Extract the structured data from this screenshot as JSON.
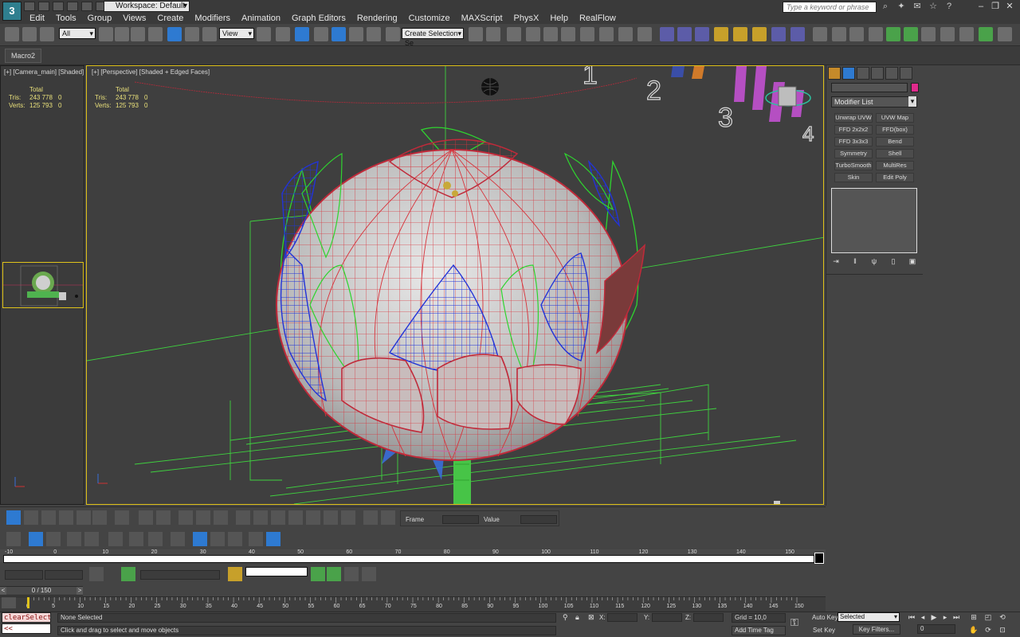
{
  "title_bar": {
    "workspace": "Workspace: Default",
    "search_placeholder": "Type a keyword or phrase"
  },
  "menu": [
    "Edit",
    "Tools",
    "Group",
    "Views",
    "Create",
    "Modifiers",
    "Animation",
    "Graph Editors",
    "Rendering",
    "Customize",
    "MAXScript",
    "PhysX",
    "Help",
    "RealFlow"
  ],
  "toolbar": {
    "selection_filter": "All",
    "ref_coord": "View",
    "named_selection": "Create Selection Se"
  },
  "ribbon": {
    "macro_tab": "Macro2"
  },
  "viewport_left": {
    "label": "[+] [Camera_main] [Shaded]",
    "stats": {
      "header": "Total",
      "tris_label": "Tris:",
      "tris_value": "243 778",
      "tris_sel": "0",
      "verts_label": "Verts:",
      "verts_value": "125 793",
      "verts_sel": "0"
    }
  },
  "viewport_main": {
    "label": "[+] [Perspective] [Shaded + Edged Faces]",
    "stats": {
      "header": "Total",
      "tris_label": "Tris:",
      "tris_value": "243 778",
      "tris_sel": "0",
      "verts_label": "Verts:",
      "verts_value": "125 793",
      "verts_sel": "0"
    },
    "background_numbers": [
      "1",
      "2",
      "3",
      "4"
    ]
  },
  "command_panel": {
    "modifier_list": "Modifier List",
    "modifiers": [
      "Unwrap UVW",
      "UVW Map",
      "FFD 2x2x2",
      "FFD(box)",
      "FFD 3x3x3",
      "Bend",
      "Symmetry",
      "Shell",
      "TurboSmooth",
      "MultiRes",
      "Skin",
      "Edit Poly"
    ],
    "object_color": "#e02a8c"
  },
  "bottom": {
    "frame_label": "Frame",
    "value_label": "Value",
    "time_slider": "0 / 150",
    "track_ruler": [
      "-10",
      "0",
      "10",
      "20",
      "30",
      "40",
      "50",
      "60",
      "70",
      "80",
      "90",
      "100",
      "110",
      "120",
      "130",
      "140",
      "150"
    ],
    "timeline": [
      "0",
      "5",
      "10",
      "15",
      "20",
      "25",
      "30",
      "35",
      "40",
      "45",
      "50",
      "55",
      "60",
      "65",
      "70",
      "75",
      "80",
      "85",
      "90",
      "95",
      "100",
      "105",
      "110",
      "115",
      "120",
      "125",
      "130",
      "135",
      "140",
      "145",
      "150"
    ]
  },
  "status": {
    "maxscript_line1": "clearSelecti(",
    "maxscript_line2": "<<",
    "selection": "None Selected",
    "prompt": "Click and drag to select and move objects",
    "x_label": "X:",
    "y_label": "Y:",
    "z_label": "Z:",
    "grid": "Grid = 10,0",
    "add_time_tag": "Add Time Tag",
    "auto_key": "Auto Key",
    "set_key": "Set Key",
    "auto_key_value": "Selected",
    "key_filters": "Key Filters...",
    "current_frame": "0"
  }
}
